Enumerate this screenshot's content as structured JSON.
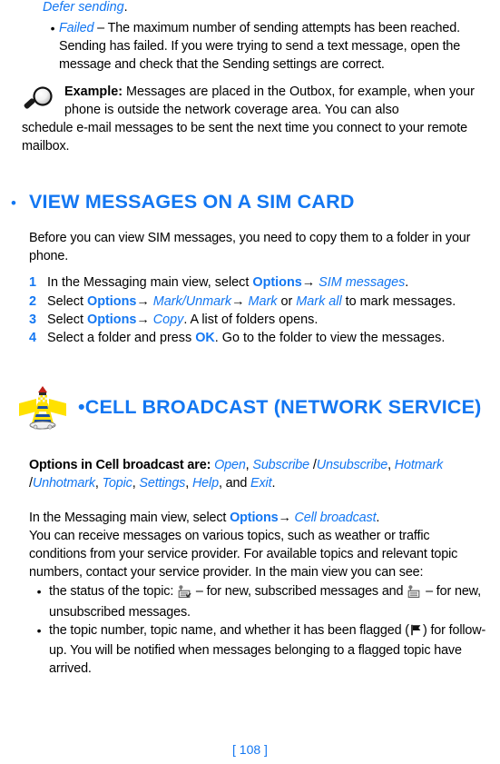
{
  "page": {
    "number_label": "[ 108 ]",
    "accent_blue": "#1377F2",
    "text_color": "#000000",
    "background": "#ffffff"
  },
  "continuation": {
    "italic_blue": "Defer sending",
    "trailing": "."
  },
  "failed_bullet": {
    "marker": "•",
    "term": "Failed",
    "dash": " – ",
    "text": "The maximum number of sending attempts has been reached. Sending has failed. If you were trying to send a text message, open the message and check that the Sending settings are correct."
  },
  "example_note": {
    "icon": "magnifier-icon",
    "label": "Example:",
    "line1": " Messages are placed in the Outbox, for example, when",
    "line2": "your phone is outside the network coverage area. You can also",
    "outdent": "schedule e-mail messages to be sent the next time you connect to your remote mailbox."
  },
  "section_sim": {
    "bullet": "•",
    "heading": "VIEW MESSAGES ON A SIM CARD",
    "intro": "Before you can view SIM messages, you need to copy them to a folder in your phone.",
    "steps": [
      {
        "num": "1",
        "pre": "In the Messaging main view, select ",
        "cmd": "Options",
        "arrow": "→ ",
        "target": "SIM messages",
        "post": "."
      },
      {
        "num": "2",
        "pre": "Select ",
        "cmd": "Options",
        "arrow": "→ ",
        "target": "Mark/Unmark",
        "arrow2": "→ ",
        "target2": "Mark",
        "mid": " or ",
        "target3": "Mark all",
        "post": " to mark messages."
      },
      {
        "num": "3",
        "pre": "Select ",
        "cmd": "Options",
        "arrow": "→ ",
        "target": "Copy",
        "post": ". A list of folders opens."
      },
      {
        "num": "4",
        "pre": "Select a folder and press ",
        "cmd": "OK",
        "post": ". Go to the folder to view the messages."
      }
    ]
  },
  "section_cell": {
    "icon": "lighthouse-beacon-icon",
    "bullet": "•",
    "heading": "CELL BROADCAST (NETWORK SERVICE)",
    "options_intro": "Options in Cell broadcast are: ",
    "options": [
      {
        "label": "Open",
        "sep": ", "
      },
      {
        "label": "Subscribe",
        "sep": " /"
      },
      {
        "label": "Unsubscribe",
        "sep": ", "
      },
      {
        "label": "Hotmark",
        "sep": " /"
      },
      {
        "label": "Unhotmark",
        "sep": ", "
      },
      {
        "label": "Topic",
        "sep": ", "
      },
      {
        "label": "Settings",
        "sep": ", "
      },
      {
        "label": "Help",
        "sep": ", and "
      },
      {
        "label": "Exit",
        "sep": "."
      }
    ],
    "main_view": {
      "pre": "In the Messaging main view, select ",
      "cmd": "Options",
      "arrow": "→ ",
      "target": "Cell broadcast",
      "post": "."
    },
    "body": "You can receive messages on various topics, such as weather or traffic conditions from your service provider. For available topics and relevant topic numbers, contact your service provider. In the main view you can see:",
    "bullets": [
      {
        "marker": "•",
        "part1": "the status of the topic: ",
        "icon1": "topic-subscribed-new-icon",
        "part2": " – for new, subscribed messages and ",
        "icon2": "topic-unsubscribed-new-icon",
        "part3": " – for new, unsubscribed messages."
      },
      {
        "marker": "•",
        "part1": "the topic number, topic name, and whether it has been flagged (",
        "icon1": "flag-icon",
        "part2": ") for follow-up. You will be notified when messages belonging to a flagged topic have arrived."
      }
    ]
  }
}
